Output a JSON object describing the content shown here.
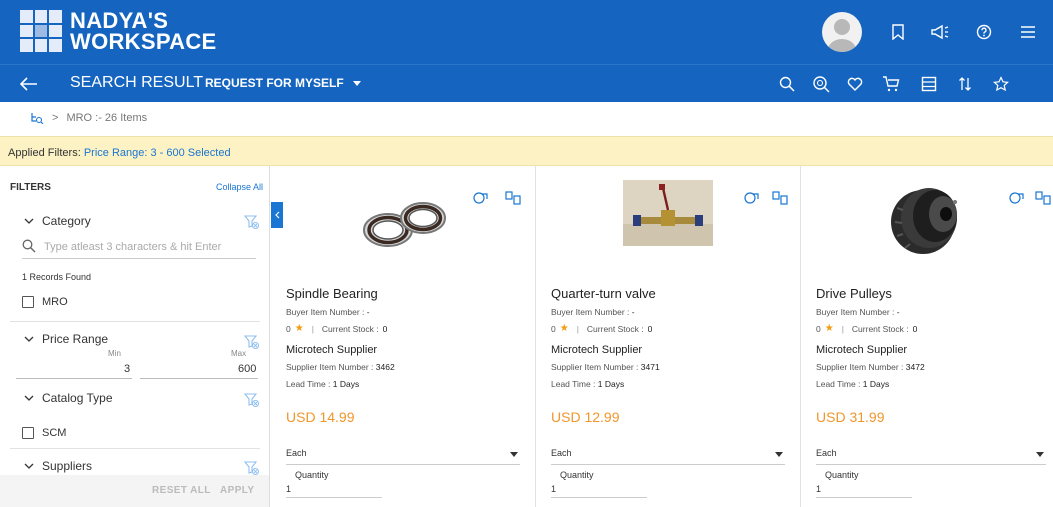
{
  "header": {
    "brand_line1": "NADYA'S",
    "brand_line2": "WORKSPACE",
    "accent_color": "#1565c0"
  },
  "searchbar": {
    "title": "SEARCH RESULT",
    "separator": "-",
    "subtitle": "REQUEST FOR MYSELF"
  },
  "breadcrumb": {
    "separator": ">",
    "text": "MRO :- 26 Items"
  },
  "applied_filters": {
    "label": "Applied Filters:",
    "value": "Price Range: 3 - 600 Selected"
  },
  "sidebar": {
    "title": "FILTERS",
    "collapse_label": "Collapse All",
    "category": {
      "title": "Category",
      "search_placeholder": "Type atleast 3 characters & hit Enter",
      "records_found": "1 Records Found",
      "option": "MRO"
    },
    "price_range": {
      "title": "Price Range",
      "min_label": "Min",
      "max_label": "Max",
      "min_value": "3",
      "max_value": "600"
    },
    "catalog_type": {
      "title": "Catalog Type",
      "option": "SCM"
    },
    "suppliers": {
      "title": "Suppliers"
    },
    "reset_label": "RESET ALL",
    "apply_label": "APPLY"
  },
  "products": [
    {
      "name": "Spindle Bearing",
      "buyer_item_label": "Buyer Item Number :",
      "buyer_item_value": "-",
      "rating": "0",
      "stock_label": "Current Stock :",
      "stock_value": "0",
      "supplier": "Microtech Supplier",
      "supplier_item_label": "Supplier Item Number :",
      "supplier_item_value": "3462",
      "lead_label": "Lead Time :",
      "lead_value": "1 Days",
      "price": "USD 14.99",
      "uom": "Each",
      "qty_label": "Quantity",
      "qty_value": "1"
    },
    {
      "name": "Quarter-turn valve",
      "buyer_item_label": "Buyer Item Number :",
      "buyer_item_value": "-",
      "rating": "0",
      "stock_label": "Current Stock :",
      "stock_value": "0",
      "supplier": "Microtech Supplier",
      "supplier_item_label": "Supplier Item Number :",
      "supplier_item_value": "3471",
      "lead_label": "Lead Time :",
      "lead_value": "1 Days",
      "price": "USD 12.99",
      "uom": "Each",
      "qty_label": "Quantity",
      "qty_value": "1"
    },
    {
      "name": "Drive Pulleys",
      "buyer_item_label": "Buyer Item Number :",
      "buyer_item_value": "-",
      "rating": "0",
      "stock_label": "Current Stock :",
      "stock_value": "0",
      "supplier": "Microtech Supplier",
      "supplier_item_label": "Supplier Item Number :",
      "supplier_item_value": "3472",
      "lead_label": "Lead Time :",
      "lead_value": "1 Days",
      "price": "USD 31.99",
      "uom": "Each",
      "qty_label": "Quantity",
      "qty_value": "1"
    }
  ]
}
